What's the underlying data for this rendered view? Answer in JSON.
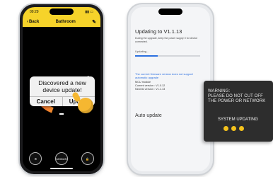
{
  "phone1": {
    "status_time": "09:29",
    "nav": {
      "back_label": "Back",
      "title": "Bathroom",
      "edit_icon": "edit-icon"
    },
    "dialog": {
      "message": "Discovered a new device update!",
      "cancel_label": "Cancel",
      "update_label": "Update"
    },
    "bottom_bar": {
      "mode_label": "MODUS"
    },
    "colors": {
      "accent": "#f6d32a",
      "dial_warm": "#e0452c",
      "hand": "#f5b731"
    }
  },
  "phone2": {
    "title": "Updating to V1.1.13",
    "subtitle": "During the upgrade, keep the power supply 0 for device connected.",
    "status": "Updating...",
    "progress": 0.35,
    "hint": "The current firmware version does not support automatic upgrade",
    "mcu": {
      "module": "MCU module",
      "current_version": "Current version : V1.0.12",
      "newest_version": "Newest version : V1.1.13"
    },
    "auto_update_label": "Auto update",
    "colors": {
      "link": "#2b6fe0"
    }
  },
  "device_panel": {
    "warning_line1": "WARNING:",
    "warning_line2": "PLEASE DO NOT CUT OFF",
    "warning_line3": "THE POWER OR NETWORK",
    "status": "SYSTEM UPDATING",
    "colors": {
      "dots": "#f4c21c",
      "background": "#2d2d2d"
    }
  }
}
